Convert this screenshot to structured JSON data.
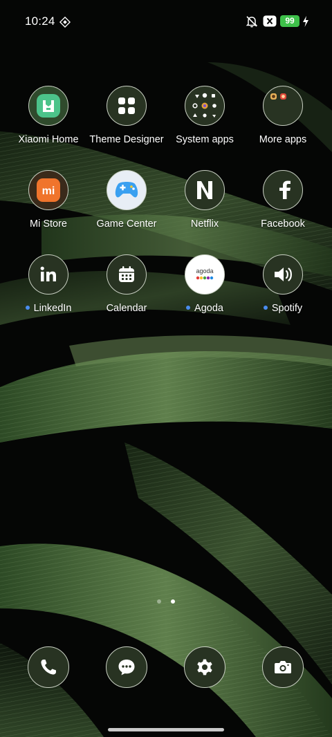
{
  "status_bar": {
    "time": "10:24",
    "battery_level": "99",
    "icons": [
      "location-diamond-icon",
      "mute-icon",
      "close-box-icon",
      "charging-bolt-icon"
    ]
  },
  "home": {
    "rows": [
      [
        {
          "label": "Xiaomi Home",
          "icon": "xiaomi-home-icon",
          "new": false
        },
        {
          "label": "Theme Designer",
          "icon": "grid-four-icon",
          "new": false
        },
        {
          "label": "System apps",
          "icon": "folder-icon",
          "new": false
        },
        {
          "label": "More apps",
          "icon": "folder-icon",
          "new": false
        }
      ],
      [
        {
          "label": "Mi Store",
          "icon": "mi-store-icon",
          "new": false
        },
        {
          "label": "Game Center",
          "icon": "gamepad-icon",
          "new": false
        },
        {
          "label": "Netflix",
          "icon": "netflix-n-icon",
          "new": false
        },
        {
          "label": "Facebook",
          "icon": "facebook-f-icon",
          "new": false
        }
      ],
      [
        {
          "label": "LinkedIn",
          "icon": "linkedin-icon",
          "new": true
        },
        {
          "label": "Calendar",
          "icon": "calendar-icon",
          "new": false
        },
        {
          "label": "Agoda",
          "icon": "agoda-icon",
          "new": true
        },
        {
          "label": "Spotify",
          "icon": "speaker-icon",
          "new": true
        }
      ]
    ]
  },
  "agoda_logo_text": "agoda",
  "mi_logo_text": "mi",
  "pager": {
    "pages": 2,
    "active": 2
  },
  "dock": [
    {
      "name": "phone",
      "icon": "phone-icon"
    },
    {
      "name": "messages",
      "icon": "chat-bubble-icon"
    },
    {
      "name": "settings",
      "icon": "gear-icon"
    },
    {
      "name": "camera",
      "icon": "camera-icon"
    }
  ],
  "colors": {
    "icon_bg": "#283322",
    "icon_border": "#c9d0c3",
    "battery_green": "#3ec04a",
    "new_dot": "#4a8df0",
    "xiaomi_home_green": "#4cc38a",
    "mi_orange": "#f0742c"
  }
}
